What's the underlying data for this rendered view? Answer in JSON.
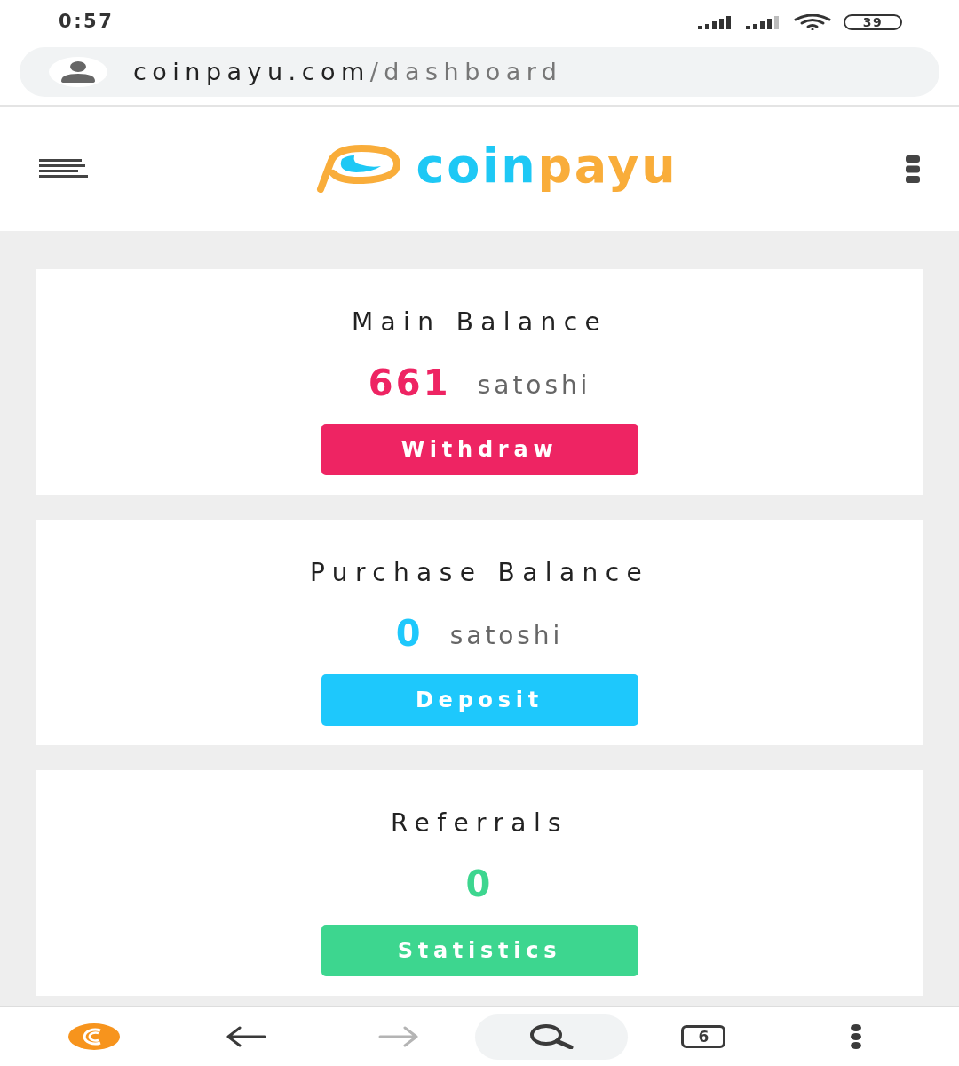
{
  "status_bar": {
    "time": "0:57",
    "battery": "39"
  },
  "address_bar": {
    "domain": "coinpayu.com",
    "path": "/dashboard"
  },
  "header": {
    "logo": [
      {
        "text": "coin",
        "color": "#1ec8f5"
      },
      {
        "text": "payu",
        "color": "#f9ad3a"
      }
    ]
  },
  "cards": [
    {
      "title": "Main Balance",
      "value": "661",
      "unit": "satoshi",
      "button": "Withdraw",
      "color": "#ee2463"
    },
    {
      "title": "Purchase Balance",
      "value": "0",
      "unit": "satoshi",
      "button": "Deposit",
      "color": "#1ec8fc"
    },
    {
      "title": "Referrals",
      "value": "0",
      "button": "Statistics",
      "color": "#3dd68f"
    }
  ],
  "bottom_nav": [
    {
      "kind": "home",
      "disabled": false
    },
    {
      "kind": "back",
      "disabled": false
    },
    {
      "kind": "forward",
      "disabled": true
    },
    {
      "kind": "search",
      "disabled": false
    },
    {
      "kind": "tabs",
      "count": "6",
      "disabled": false
    },
    {
      "kind": "menu",
      "disabled": false
    }
  ]
}
